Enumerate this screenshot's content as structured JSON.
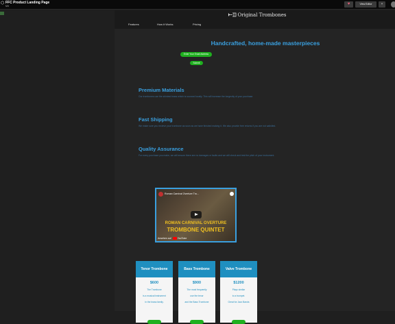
{
  "topbar": {
    "title": "FFC Product Landing Page",
    "subtitle": "Mit",
    "heart_icon": "heart-icon",
    "view_editor_label": "View Editor",
    "fork_icon": "fork-icon"
  },
  "header": {
    "brand": "Original Trombones",
    "brand_icon": "trombone-icon",
    "nav": [
      "Features",
      "How it Works",
      "Pricing"
    ]
  },
  "hero": {
    "title": "Handcrafted, home-made masterpieces",
    "email_placeholder": "Enter Your Email Address",
    "submit_label": "Submit"
  },
  "features": [
    {
      "title": "Premium Materials",
      "text": "Our trombones use the shiniest brass which is sourced locally. This will increase the longevity of your purchase."
    },
    {
      "title": "Fast Shipping",
      "text": "We make sure you recieve your trombone as soon as we have finished making it. We also provide free returns if you are not satisfied."
    },
    {
      "title": "Quality Assurance",
      "text": "For every purchase you make, we will ensure there are no damages or faults and we will check and test the pitch of your instrument."
    }
  ],
  "video": {
    "title": "Roman Carnival Overture Tro...",
    "share_label": "Teilen",
    "line1": "ROMAN CARNIVAL OVERTURE",
    "line2": "TROMBONE QUINTET",
    "watch_on": "Ansehen auf",
    "youtube": "YouTube"
  },
  "pricing": [
    {
      "name": "Tenor Trombone",
      "price": "$600",
      "lines": [
        "The Trombone",
        "is a musical instrument",
        "in the brass family."
      ]
    },
    {
      "name": "Bass Trombone",
      "price": "$900",
      "lines": [
        "The most frequently",
        "use the tenor",
        "and the Bass Trombone"
      ]
    },
    {
      "name": "Valve Trombone",
      "price": "$1200",
      "lines": [
        "Plays similar",
        "to a trumpet.",
        "Great for Jazz Bands"
      ]
    }
  ],
  "colors": {
    "accent": "#3aa0e0",
    "green": "#1fb01f",
    "background": "#242424"
  }
}
